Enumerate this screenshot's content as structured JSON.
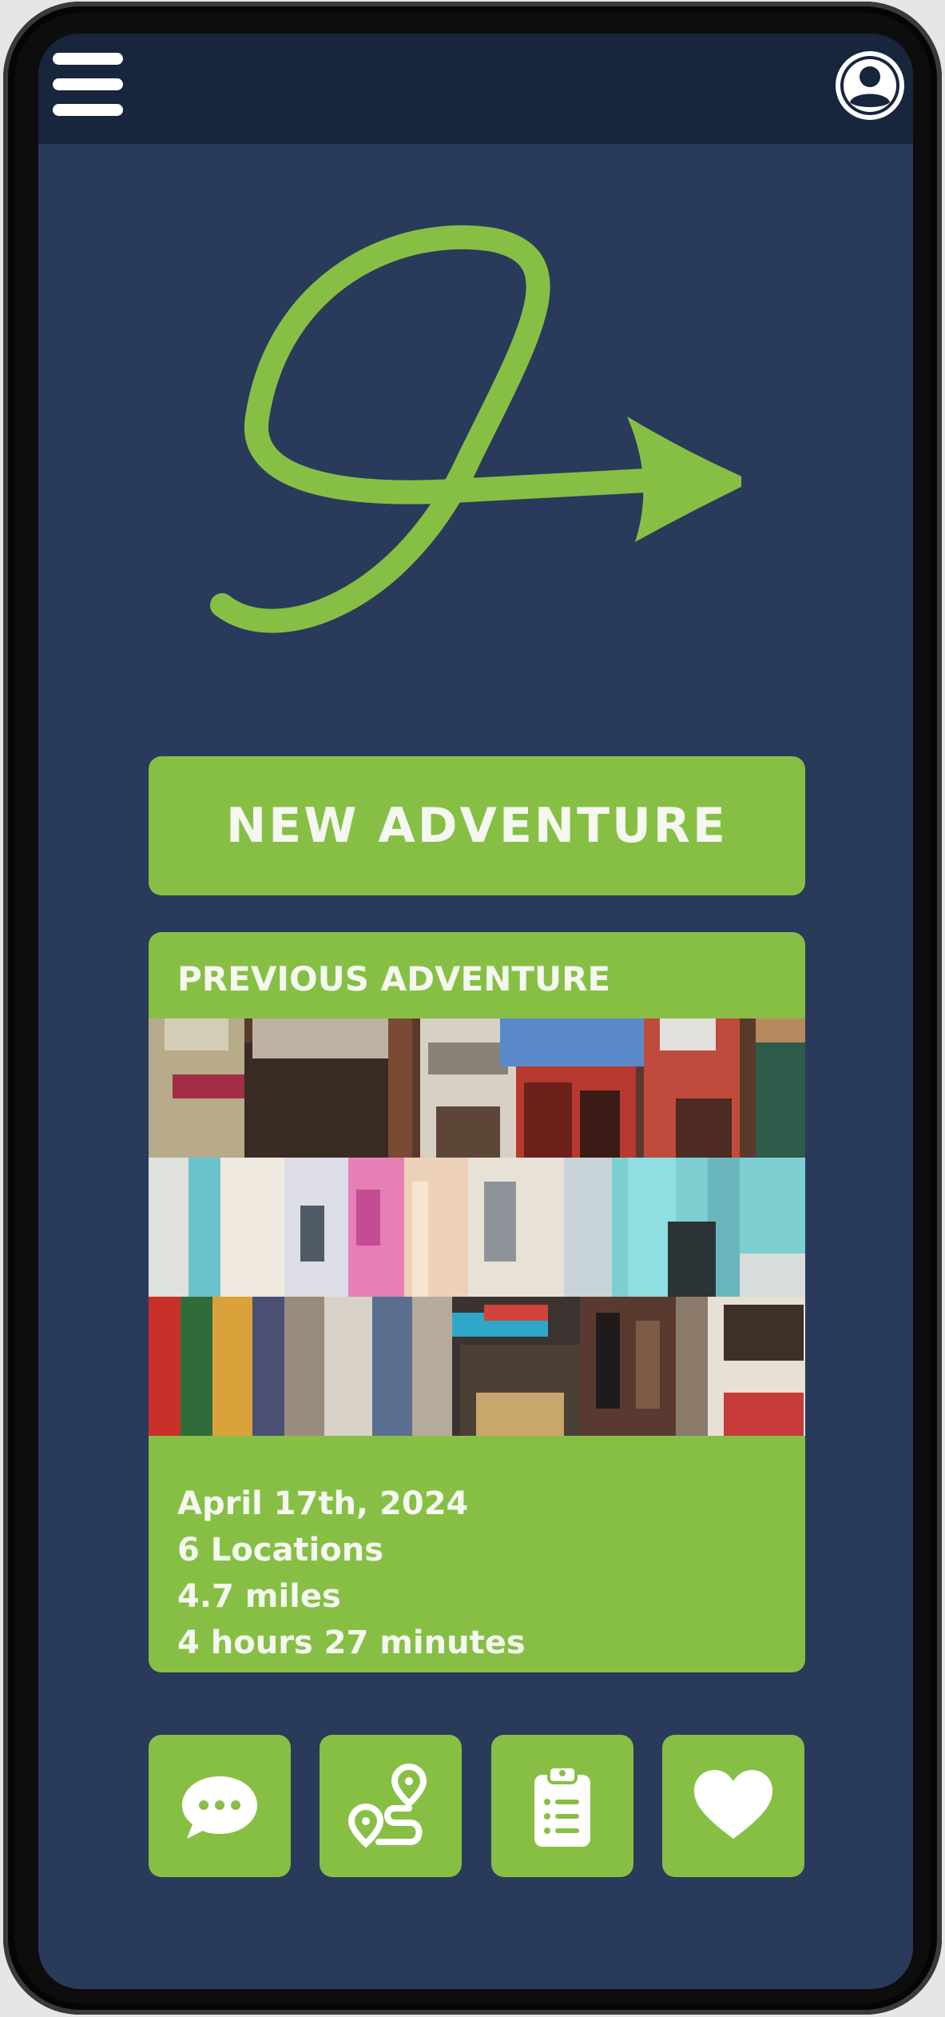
{
  "header": {
    "menu_icon": "hamburger-menu-icon",
    "profile_icon": "user-profile-icon"
  },
  "logo": {
    "icon": "looping-arrow-logo",
    "color": "#87bf45"
  },
  "new_adventure_label": "NEW ADVENTURE",
  "previous_adventure": {
    "title": "PREVIOUS ADVENTURE",
    "photos": [
      "street-storefronts-photo",
      "pastel-houses-photo",
      "market-stalls-photo"
    ],
    "date": "April 17th, 2024",
    "locations": "6 Locations",
    "distance": "4.7 miles",
    "duration": "4 hours 27 minutes"
  },
  "actions": [
    {
      "icon": "chat-bubble-icon"
    },
    {
      "icon": "route-icon"
    },
    {
      "icon": "clipboard-list-icon"
    },
    {
      "icon": "heart-icon"
    }
  ],
  "colors": {
    "accent": "#87bf45",
    "background": "#2a3a5a",
    "topbar": "#17253d",
    "text_light": "#f4f8f0"
  }
}
